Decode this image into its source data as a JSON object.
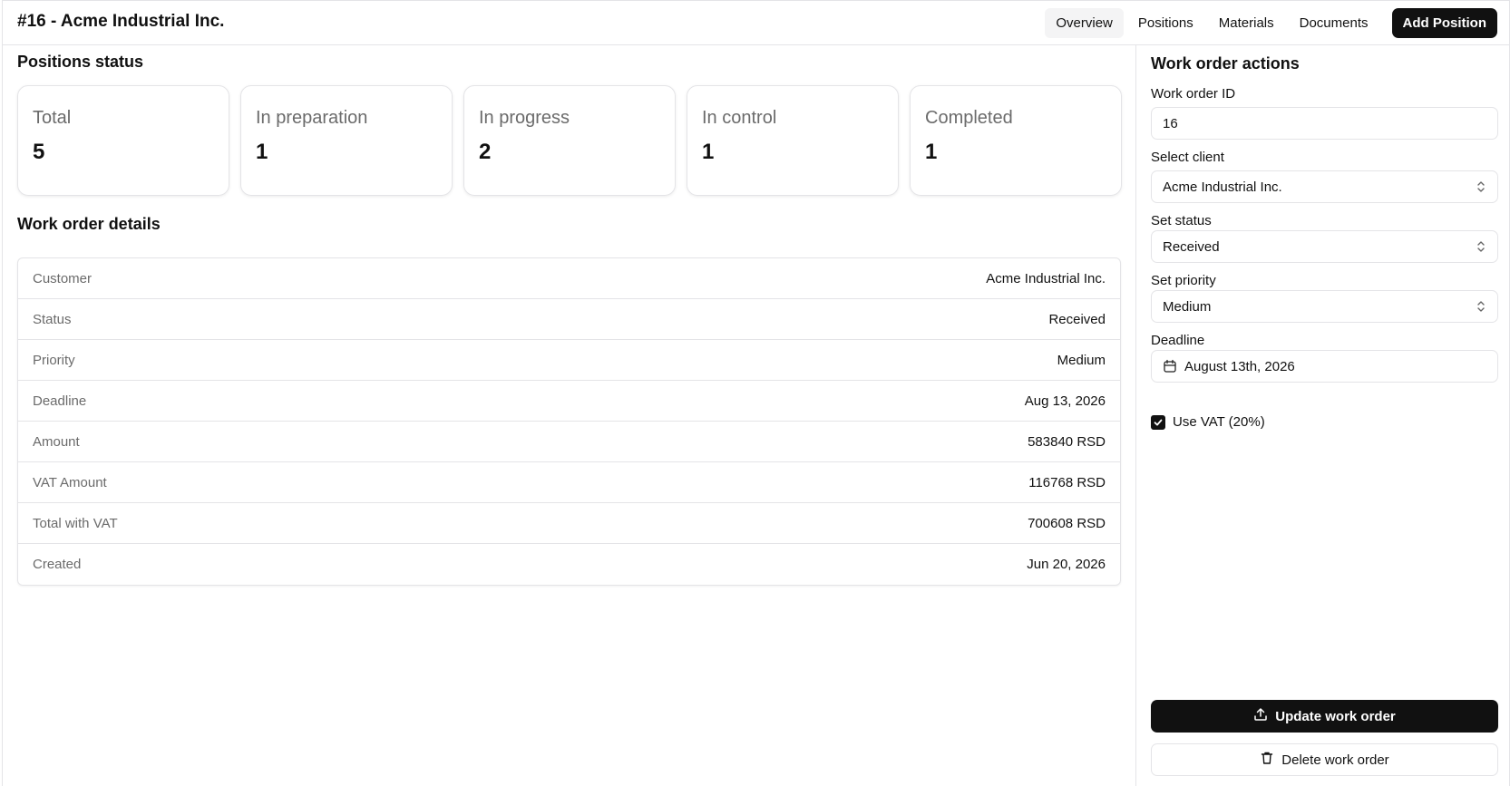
{
  "header": {
    "title": "#16 - Acme Industrial Inc.",
    "tabs": [
      {
        "label": "Overview",
        "active": true
      },
      {
        "label": "Positions",
        "active": false
      },
      {
        "label": "Materials",
        "active": false
      },
      {
        "label": "Documents",
        "active": false
      }
    ],
    "add_position_label": "Add Position"
  },
  "positions_status": {
    "title": "Positions status",
    "cards": [
      {
        "label": "Total",
        "value": "5"
      },
      {
        "label": "In preparation",
        "value": "1"
      },
      {
        "label": "In progress",
        "value": "2"
      },
      {
        "label": "In control",
        "value": "1"
      },
      {
        "label": "Completed",
        "value": "1"
      }
    ]
  },
  "details": {
    "title": "Work order details",
    "rows": [
      {
        "label": "Customer",
        "value": "Acme Industrial Inc."
      },
      {
        "label": "Status",
        "value": "Received"
      },
      {
        "label": "Priority",
        "value": "Medium"
      },
      {
        "label": "Deadline",
        "value": "Aug 13, 2026"
      },
      {
        "label": "Amount",
        "value": "583840 RSD"
      },
      {
        "label": "VAT Amount",
        "value": "116768 RSD"
      },
      {
        "label": "Total with VAT",
        "value": "700608 RSD"
      },
      {
        "label": "Created",
        "value": "Jun 20, 2026"
      }
    ]
  },
  "actions": {
    "title": "Work order actions",
    "work_order_id": {
      "label": "Work order ID",
      "value": "16"
    },
    "client": {
      "label": "Select client",
      "value": "Acme Industrial Inc."
    },
    "status": {
      "label": "Set status",
      "value": "Received"
    },
    "priority": {
      "label": "Set priority",
      "value": "Medium"
    },
    "deadline": {
      "label": "Deadline",
      "value": "August 13th, 2026"
    },
    "vat": {
      "label": "Use VAT (20%)",
      "checked": true
    },
    "update_label": "Update work order",
    "delete_label": "Delete work order"
  },
  "icons": {
    "deadline": "calendar-icon",
    "update": "upload-icon",
    "delete": "trash-icon",
    "select": "chevrons-up-down-icon",
    "checkbox": "check-icon"
  },
  "colors": {
    "primary": "#111111",
    "border": "#e4e4e7",
    "muted_text": "#6b6b6b",
    "active_tab_bg": "#f4f4f5"
  }
}
